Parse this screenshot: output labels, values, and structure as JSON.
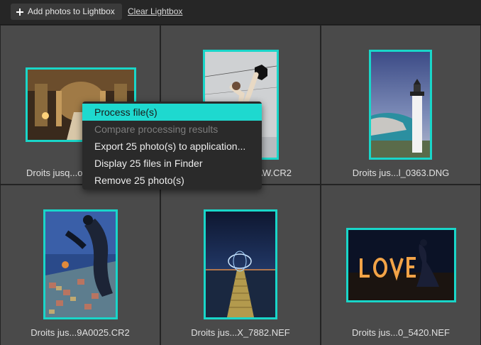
{
  "toolbar": {
    "add_label": "Add photos to Lightbox",
    "clear_label": "Clear Lightbox"
  },
  "photos": [
    {
      "caption": "Droits jusq...o"
    },
    {
      "caption": "AW.CR2"
    },
    {
      "caption": "Droits jus...l_0363.DNG"
    },
    {
      "caption": "Droits jus...9A0025.CR2"
    },
    {
      "caption": "Droits jus...X_7882.NEF"
    },
    {
      "caption": "Droits jus...0_5420.NEF"
    }
  ],
  "context_menu": {
    "items": [
      {
        "label": "Process file(s)",
        "state": "highlighted"
      },
      {
        "label": "Compare processing results",
        "state": "disabled"
      },
      {
        "label": "Export 25 photo(s) to application...",
        "state": "enabled"
      },
      {
        "label": "Display 25 files in Finder",
        "state": "enabled"
      },
      {
        "label": "Remove 25 photo(s)",
        "state": "enabled"
      }
    ]
  },
  "colors": {
    "accent": "#1ed9cf",
    "thumb_border": "#19d6c9",
    "cell_bg": "#4a4a4a",
    "toolbar_bg": "#262626"
  }
}
